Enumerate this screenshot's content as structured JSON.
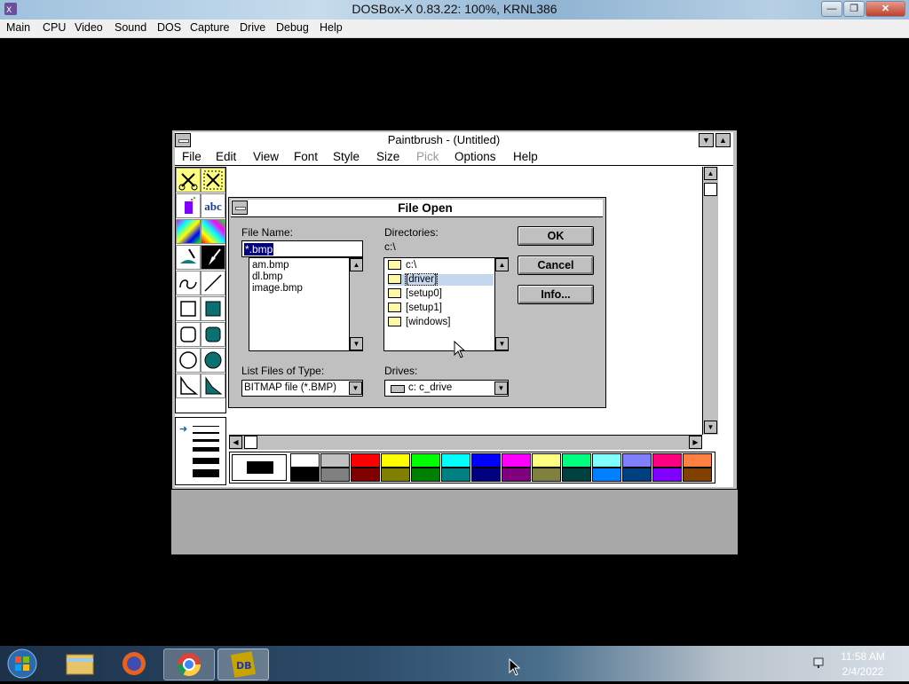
{
  "host": {
    "title": "DOSBox-X 0.83.22: 100%, KRNL386",
    "menu": [
      "Main",
      "CPU",
      "Video",
      "Sound",
      "DOS",
      "Capture",
      "Drive",
      "Debug",
      "Help"
    ],
    "controls": {
      "minimize": "—",
      "restore": "❐",
      "close": "✕"
    }
  },
  "paintbrush": {
    "title": "Paintbrush - (Untitled)",
    "menu": [
      {
        "label": "File",
        "enabled": true
      },
      {
        "label": "Edit",
        "enabled": true
      },
      {
        "label": "View",
        "enabled": true
      },
      {
        "label": "Font",
        "enabled": true
      },
      {
        "label": "Style",
        "enabled": true
      },
      {
        "label": "Size",
        "enabled": true
      },
      {
        "label": "Pick",
        "enabled": false
      },
      {
        "label": "Options",
        "enabled": true
      },
      {
        "label": "Help",
        "enabled": true
      }
    ],
    "tools": [
      "scissors-icon",
      "pick-icon",
      "airbrush-icon",
      "text-icon",
      "color-eraser-icon",
      "eraser-icon",
      "paint-roller-icon",
      "brush-icon",
      "curve-icon",
      "line-icon",
      "box-icon",
      "filled-box-icon",
      "rounded-box-icon",
      "filled-rounded-box-icon",
      "circle-icon",
      "filled-circle-icon",
      "polygon-icon",
      "filled-polygon-icon"
    ],
    "text_tool_label": "abc",
    "palette_fg": "#000000",
    "palette_bg": "#ffffff",
    "palette_top": [
      "#ffffff",
      "#c0c0c0",
      "#ff0000",
      "#ffff00",
      "#00ff00",
      "#00ffff",
      "#0000ff",
      "#ff00ff",
      "#ffff80",
      "#00ff80",
      "#80ffff",
      "#8080ff",
      "#ff0080",
      "#ff8040"
    ],
    "palette_bottom": [
      "#000000",
      "#808080",
      "#800000",
      "#808000",
      "#008000",
      "#008080",
      "#000080",
      "#800080",
      "#808040",
      "#004040",
      "#0080ff",
      "#004080",
      "#8000ff",
      "#804000"
    ]
  },
  "dialog": {
    "title": "File Open",
    "file_name_label": "File Name:",
    "file_name_value": "*.bmp",
    "files": [
      "am.bmp",
      "dl.bmp",
      "image.bmp"
    ],
    "directories_label": "Directories:",
    "current_dir": "c:\\",
    "dirs": [
      {
        "label": "c:\\",
        "open": true,
        "selected": false
      },
      {
        "label": "[driver]",
        "open": false,
        "selected": true
      },
      {
        "label": "[setup0]",
        "open": false,
        "selected": false
      },
      {
        "label": "[setup1]",
        "open": false,
        "selected": false
      },
      {
        "label": "[windows]",
        "open": false,
        "selected": false
      }
    ],
    "type_label": "List Files of Type:",
    "type_value": "BITMAP file (*.BMP)",
    "drives_label": "Drives:",
    "drive_value": "c: c_drive",
    "ok_label": "OK",
    "cancel_label": "Cancel",
    "info_label": "Info..."
  },
  "taskbar": {
    "time": "11:58 AM",
    "date": "2/4/2022",
    "apps": [
      "start-orb-icon",
      "file-explorer-icon",
      "firefox-icon",
      "chrome-icon",
      "dosbox-icon"
    ]
  }
}
